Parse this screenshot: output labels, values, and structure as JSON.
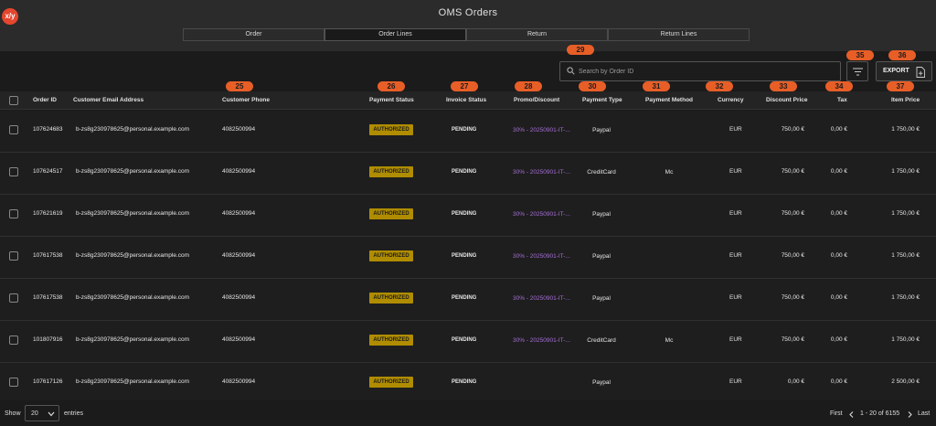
{
  "app": {
    "logo": "x/y",
    "title": "OMS Orders"
  },
  "tabs": [
    {
      "label": "Order",
      "active": false
    },
    {
      "label": "Order Lines",
      "active": true
    },
    {
      "label": "Return",
      "active": false
    },
    {
      "label": "Return Lines",
      "active": false
    }
  ],
  "toolbar": {
    "search_placeholder": "Search by Order ID",
    "export_label": "EXPORT",
    "icons": [
      "search-icon",
      "filter-icon",
      "export-file-icon"
    ]
  },
  "badges": {
    "search": "29",
    "filter": "35",
    "export": "36",
    "customer_phone": "25",
    "payment_status": "26",
    "invoice_status": "27",
    "promo_discount": "28",
    "payment_type": "30",
    "payment_method": "31",
    "currency": "32",
    "discount_price": "33",
    "tax": "34",
    "item_price": "37"
  },
  "columns": {
    "order_id": "Order ID",
    "email": "Customer Email Address",
    "phone": "Customer Phone",
    "payment_status": "Payment Status",
    "invoice_status": "Invoice Status",
    "promo": "Promo/Discount",
    "payment_type": "Payment Type",
    "payment_method": "Payment Method",
    "currency": "Currency",
    "discount_price": "Discount Price",
    "tax": "Tax",
    "item_price": "Item Price"
  },
  "rows": [
    {
      "order_id": "107624683",
      "email": "b-zs8g230978625@personal.example.com",
      "phone": "4082500994",
      "payment_status": "AUTHORIZED",
      "invoice_status": "PENDING",
      "promo": "30% - 20250901-IT-...",
      "payment_type": "Paypal",
      "payment_method": "",
      "currency": "EUR",
      "discount_price": "750,00 €",
      "tax": "0,00 €",
      "item_price": "1 750,00 €"
    },
    {
      "order_id": "107624517",
      "email": "b-zs8g230978625@personal.example.com",
      "phone": "4082500994",
      "payment_status": "AUTHORIZED",
      "invoice_status": "PENDING",
      "promo": "30% - 20250901-IT-...",
      "payment_type": "CreditCard",
      "payment_method": "Mc",
      "currency": "EUR",
      "discount_price": "750,00 €",
      "tax": "0,00 €",
      "item_price": "1 750,00 €"
    },
    {
      "order_id": "107621619",
      "email": "b-zs8g230978625@personal.example.com",
      "phone": "4082500994",
      "payment_status": "AUTHORIZED",
      "invoice_status": "PENDING",
      "promo": "30% - 20250901-IT-...",
      "payment_type": "Paypal",
      "payment_method": "",
      "currency": "EUR",
      "discount_price": "750,00 €",
      "tax": "0,00 €",
      "item_price": "1 750,00 €"
    },
    {
      "order_id": "107617538",
      "email": "b-zs8g230978625@personal.example.com",
      "phone": "4082500994",
      "payment_status": "AUTHORIZED",
      "invoice_status": "PENDING",
      "promo": "30% - 20250901-IT-...",
      "payment_type": "Paypal",
      "payment_method": "",
      "currency": "EUR",
      "discount_price": "750,00 €",
      "tax": "0,00 €",
      "item_price": "1 750,00 €"
    },
    {
      "order_id": "107617538",
      "email": "b-zs8g230978625@personal.example.com",
      "phone": "4082500994",
      "payment_status": "AUTHORIZED",
      "invoice_status": "PENDING",
      "promo": "30% - 20250901-IT-...",
      "payment_type": "Paypal",
      "payment_method": "",
      "currency": "EUR",
      "discount_price": "750,00 €",
      "tax": "0,00 €",
      "item_price": "1 750,00 €"
    },
    {
      "order_id": "101807916",
      "email": "b-zs8g230978625@personal.example.com",
      "phone": "4082500994",
      "payment_status": "AUTHORIZED",
      "invoice_status": "PENDING",
      "promo": "30% - 20250901-IT-...",
      "payment_type": "CreditCard",
      "payment_method": "Mc",
      "currency": "EUR",
      "discount_price": "750,00 €",
      "tax": "0,00 €",
      "item_price": "1 750,00 €"
    },
    {
      "order_id": "107617126",
      "email": "b-zs8g230978625@personal.example.com",
      "phone": "4082500994",
      "payment_status": "AUTHORIZED",
      "invoice_status": "PENDING",
      "promo": "",
      "payment_type": "Paypal",
      "payment_method": "",
      "currency": "EUR",
      "discount_price": "0,00 €",
      "tax": "0,00 €",
      "item_price": "2 500,00 €"
    }
  ],
  "footer": {
    "show_label": "Show",
    "page_size": "20",
    "entries_label": "entries",
    "first_label": "First",
    "range_label": "1 - 20 of 6155",
    "last_label": "Last"
  },
  "colors": {
    "background": "#1b1b1b",
    "header": "#2b2b2b",
    "badge": "#e85e27",
    "authorized": "#b08d00",
    "promo": "#a56fd6",
    "logo": "#e4472e"
  }
}
